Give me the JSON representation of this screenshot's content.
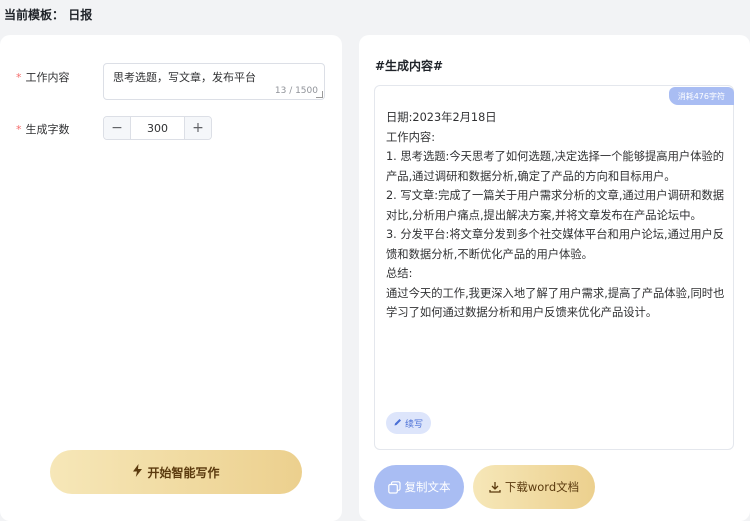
{
  "header": {
    "template_label": "当前模板：",
    "template_name": "日报"
  },
  "form": {
    "content_label": "工作内容",
    "content_value": "思考选题，写文章，发布平台",
    "content_counter": "13 / 1500",
    "words_label": "生成字数",
    "words_value": "300",
    "minus_label": "−",
    "plus_label": "+",
    "required_mark": "*"
  },
  "generate_button": {
    "label": "开始智能写作"
  },
  "result": {
    "title": "#生成内容#",
    "badge": "消耗476字符",
    "lines": [
      "日期:2023年2月18日",
      "工作内容:",
      "1. 思考选题:今天思考了如何选题,决定选择一个能够提高用户体验的产品,通过调研和数据分析,确定了产品的方向和目标用户。",
      "2. 写文章:完成了一篇关于用户需求分析的文章,通过用户调研和数据对比,分析用户痛点,提出解决方案,并将文章发布在产品论坛中。",
      "3. 分发平台:将文章分发到多个社交媒体平台和用户论坛,通过用户反馈和数据分析,不断优化产品的用户体验。",
      "总结:",
      "通过今天的工作,我更深入地了解了用户需求,提高了产品体验,同时也学习了如何通过数据分析和用户反馈来优化产品设计。"
    ],
    "continue_label": "续写",
    "copy_label": "复制文本",
    "download_label": "下载word文档"
  }
}
